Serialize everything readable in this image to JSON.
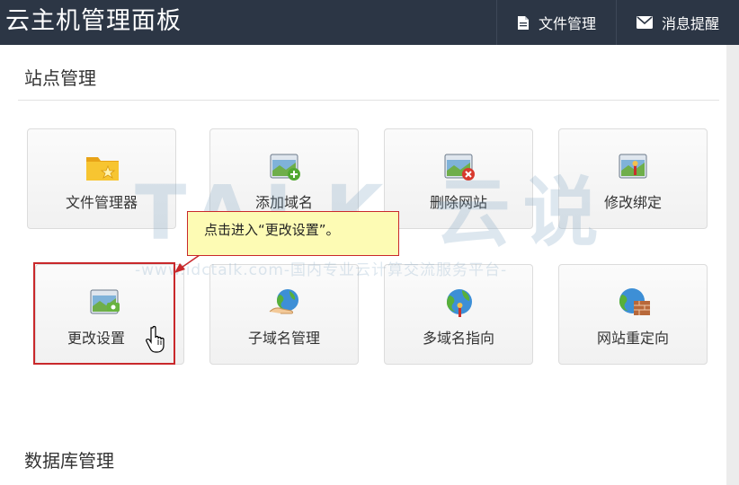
{
  "header": {
    "title": "云主机管理面板",
    "nav": [
      {
        "label": "文件管理",
        "icon": "file-icon"
      },
      {
        "label": "消息提醒",
        "icon": "mail-icon"
      }
    ]
  },
  "site_section": {
    "title": "站点管理",
    "tiles": [
      {
        "label": "文件管理器",
        "icon": "folder-star-icon"
      },
      {
        "label": "添加域名",
        "icon": "window-add-icon"
      },
      {
        "label": "删除网站",
        "icon": "window-delete-icon"
      },
      {
        "label": "修改绑定",
        "icon": "window-bind-icon"
      },
      {
        "label": "更改设置",
        "icon": "window-settings-icon"
      },
      {
        "label": "子域名管理",
        "icon": "globe-hand-icon"
      },
      {
        "label": "多域名指向",
        "icon": "globe-pin-icon"
      },
      {
        "label": "网站重定向",
        "icon": "globe-wall-icon"
      }
    ]
  },
  "db_section": {
    "title": "数据库管理"
  },
  "callout": {
    "text": "点击进入“更改设置”。"
  },
  "watermark": {
    "brand": "TALK 云说",
    "url": "-www.idctalk.com-国内专业云计算交流服务平台-"
  },
  "colors": {
    "topbar": "#2c3645",
    "highlight": "#c9282b",
    "callout_bg": "#fdfbb4"
  }
}
